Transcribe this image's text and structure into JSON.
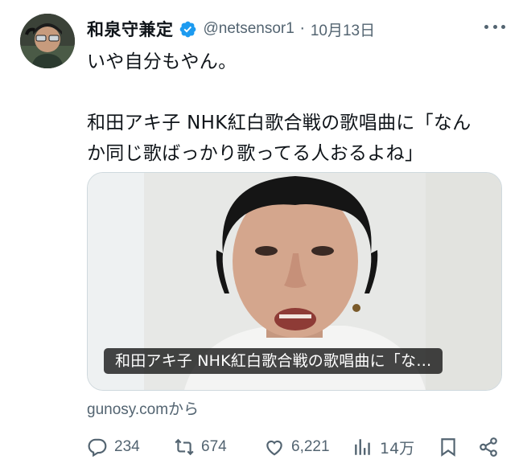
{
  "author": {
    "display_name": "和泉守兼定",
    "handle": "@netsensor1",
    "separator": "·",
    "date": "10月13日",
    "verified": true
  },
  "tweet": {
    "line1": "いや自分もやん。",
    "line2": "和田アキ子 NHK紅白歌合戦の歌唱曲に「なん",
    "line3": "か同じ歌ばっかり歌ってる人おるよね」"
  },
  "card": {
    "caption": "和田アキ子 NHK紅白歌合戦の歌唱曲に「な…",
    "source_domain": "gunosy.com",
    "source_suffix": "から"
  },
  "actions": {
    "replies": "234",
    "retweets": "674",
    "likes": "6,221",
    "views": "14万"
  },
  "colors": {
    "text": "#0f1419",
    "secondary": "#536471",
    "verified_blue": "#1d9bf0",
    "border": "#cfd9de"
  },
  "icons": [
    "verified-badge-icon",
    "more-icon",
    "reply-icon",
    "retweet-icon",
    "like-icon",
    "views-icon",
    "bookmark-icon",
    "share-icon"
  ]
}
